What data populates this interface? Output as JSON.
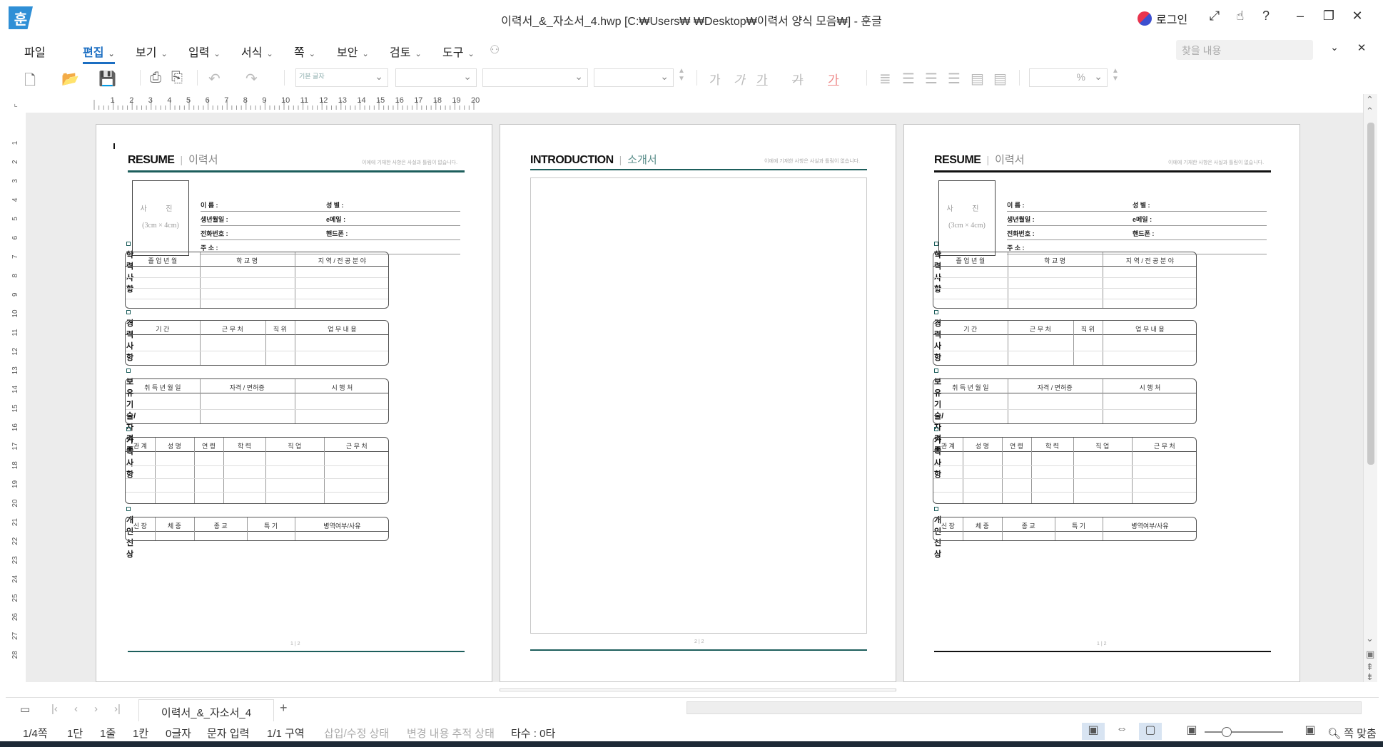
{
  "window": {
    "title": "이력서_&_자소서_4.hwp [C:₩Users₩      ₩Desktop₩이력서 양식 모음₩] - 훈글",
    "app_logo": "훈",
    "login_label": "로그인"
  },
  "menu": {
    "file": "파일",
    "items": [
      "편집",
      "보기",
      "입력",
      "서식",
      "쪽",
      "보안",
      "검토",
      "도구"
    ],
    "active": "편집",
    "search_placeholder": "찾을 내용"
  },
  "toolbar": {
    "style_combo": "기본 글자",
    "percent_unit": "%",
    "char_buttons": [
      "가",
      "가",
      "가",
      "가",
      "가"
    ]
  },
  "ruler": {
    "h_ticks": [
      "1",
      "2",
      "3",
      "4",
      "5",
      "6",
      "7",
      "8",
      "9",
      "10",
      "11",
      "12",
      "13",
      "14",
      "15",
      "16",
      "17",
      "18",
      "19",
      "20"
    ],
    "v_ticks": [
      "1",
      "2",
      "3",
      "4",
      "5",
      "6",
      "7",
      "8",
      "9",
      "10",
      "11",
      "12",
      "13",
      "14",
      "15",
      "16",
      "17",
      "18",
      "19",
      "20",
      "21",
      "22",
      "23",
      "24",
      "25",
      "26",
      "27",
      "28"
    ]
  },
  "resume": {
    "title_en": "RESUME",
    "title_ko": "이력서",
    "note": "이에에 기재한 사항은 사실과 틀림이 없습니다.",
    "photo_label": "사 진",
    "photo_size": "(3cm × 4cm)",
    "fields_left": [
      "이    름 :",
      "생년월일 :",
      "전화번호 :",
      "주    소 :"
    ],
    "fields_right": [
      "성  별 :",
      "e메일 :",
      "핸드폰 :"
    ],
    "sections": [
      {
        "title": "학력사항",
        "cols": [
          "졸 업 년 월",
          "학    교    명",
          "지 역 / 전 공 분 야"
        ]
      },
      {
        "title": "경력사항",
        "cols": [
          "기        간",
          "근 무 처",
          "직 위",
          "업    무    내    용"
        ]
      },
      {
        "title": "보유기술/자격증",
        "cols": [
          "취 득 년 월 일",
          "자격 / 면허증",
          "시      행      처"
        ]
      },
      {
        "title": "가족사항",
        "cols": [
          "관 계",
          "성    명",
          "연 령",
          "학        력",
          "직    업",
          "근    무    처"
        ]
      },
      {
        "title": "개인신상",
        "cols": [
          "신 장",
          "체    중",
          "종    교",
          "특        기",
          "병역여부/사유"
        ]
      }
    ],
    "page_num_1": "1 | 2",
    "page_num_3": "1 | 2"
  },
  "intro": {
    "title_en": "INTRODUCTION",
    "title_ko": "소개서",
    "note": "이에에 기재한 사항은 사실과 틀림이 없습니다.",
    "page_num": "2 | 2"
  },
  "tabs": {
    "doc_tab": "이력서_&_자소서_4",
    "add": "+"
  },
  "status": {
    "page": "1/4쪽",
    "column": "1단",
    "line": "1줄",
    "col": "1칸",
    "chars": "0글자",
    "input_mode": "문자 입력",
    "section": "1/1 구역",
    "insert_state": "삽입/수정 상태",
    "track": "변경 내용 추적 상태",
    "typing": "타수 : 0타",
    "fit": "쪽 맞춤"
  },
  "colors": {
    "accent": "#1b6ec2",
    "teal_rule": "#1d5e5c",
    "doc_bg": "#ececec"
  }
}
